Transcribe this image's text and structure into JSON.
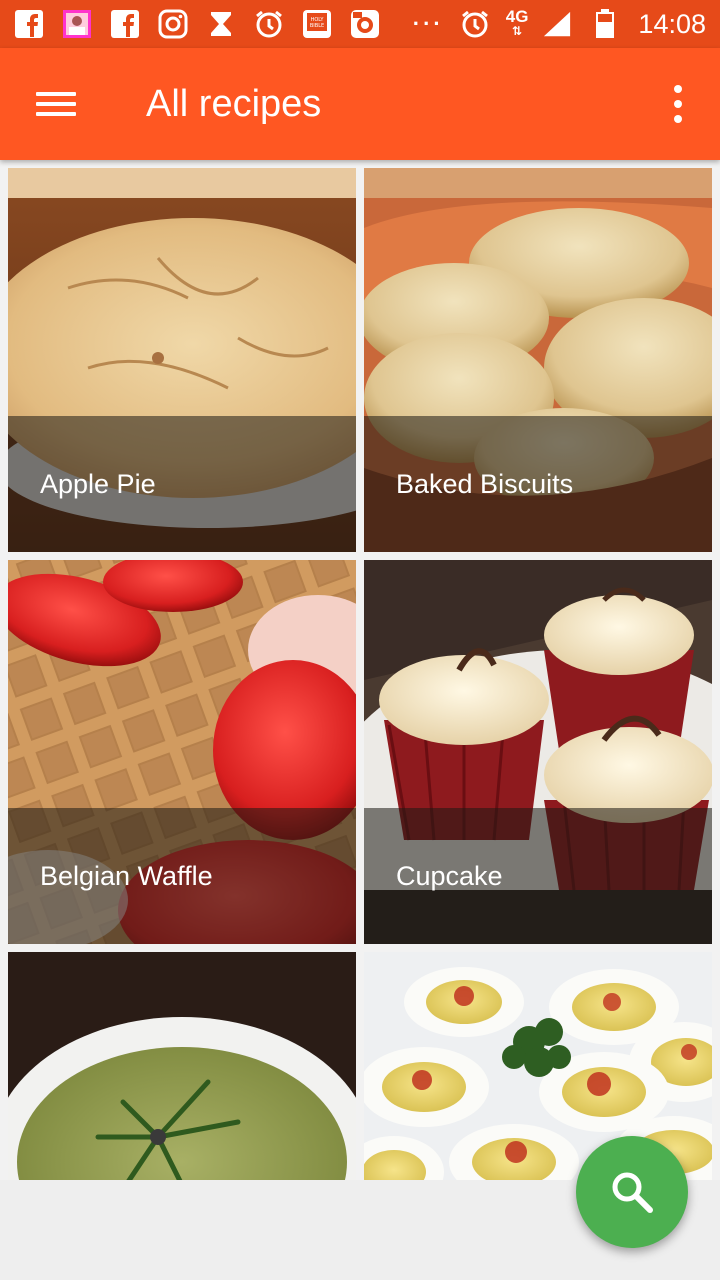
{
  "status_bar": {
    "icons_left": [
      "facebook-icon",
      "photo-app-icon",
      "facebook-icon",
      "instagram-icon",
      "hourglass-icon",
      "alarm-icon",
      "bible-app-icon",
      "camera-app-icon"
    ],
    "more_label": "···",
    "network": "4G",
    "time": "14:08"
  },
  "toolbar": {
    "title": "All recipes",
    "menu_icon": "hamburger-menu-icon",
    "overflow_icon": "more-vert-icon"
  },
  "recipes": [
    {
      "name": "Apple Pie"
    },
    {
      "name": "Baked Biscuits"
    },
    {
      "name": "Belgian Waffle"
    },
    {
      "name": "Cupcake"
    },
    {
      "name": ""
    },
    {
      "name": ""
    }
  ],
  "fab": {
    "icon": "search-icon",
    "color": "#4caf50"
  },
  "colors": {
    "status_bar": "#e64a19",
    "toolbar": "#ff5722",
    "accent": "#4caf50"
  }
}
